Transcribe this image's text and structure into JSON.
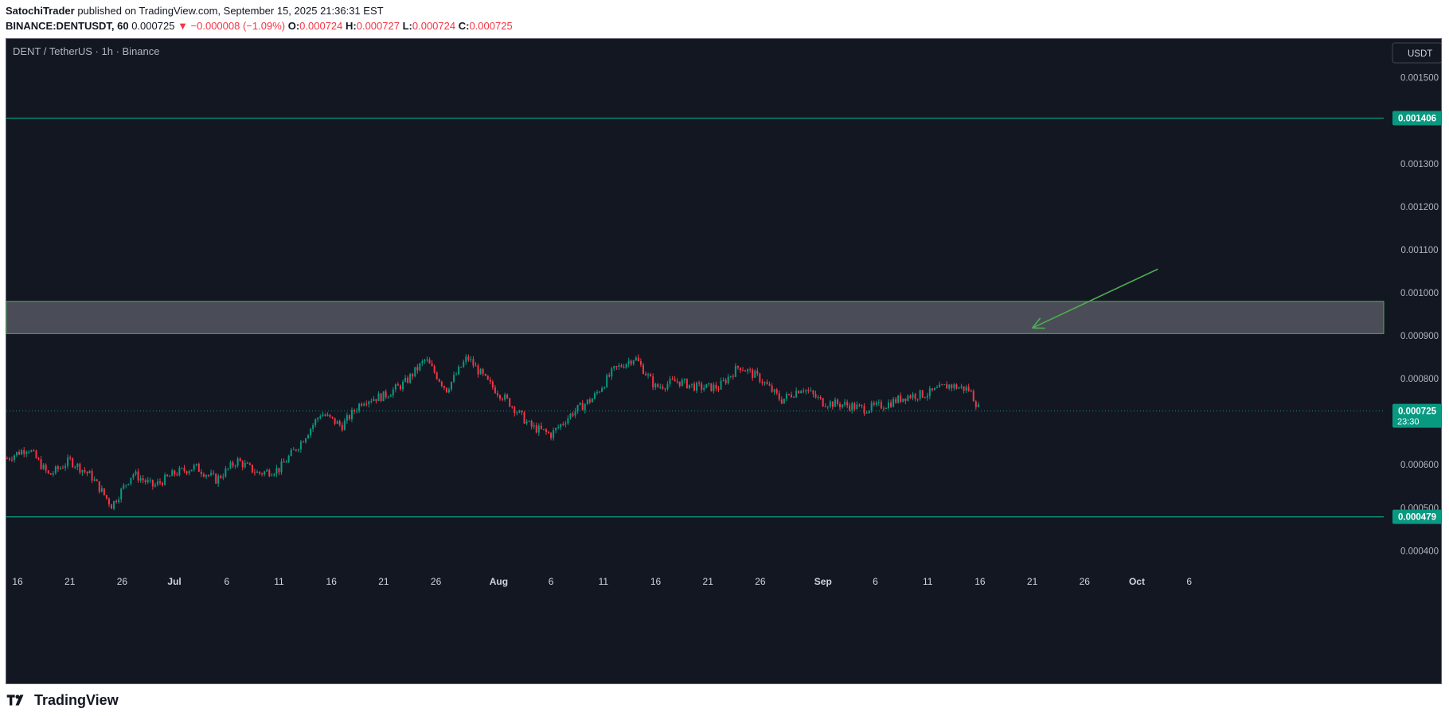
{
  "header": {
    "author": "SatochiTrader",
    "published": "published on TradingView.com, September 15, 2025 21:36:31 EST",
    "symbol": "BINANCE:DENTUSDT, 60",
    "last": "0.000725",
    "change": "▼ −0.000008 (−1.09%)",
    "o_label": "O:",
    "o": "0.000724",
    "h_label": "H:",
    "h": "0.000727",
    "l_label": "L:",
    "l": "0.000724",
    "c_label": "C:",
    "c": "0.000725"
  },
  "footer": {
    "brand": "TradingView"
  },
  "chart_data": {
    "type": "line",
    "title": "DENT / TetherUS · 1h · Binance",
    "currency_button": "USDT",
    "ylim": [
      0.00036,
      0.00159
    ],
    "y_ticks": [
      "0.001500",
      "0.001300",
      "0.001200",
      "0.001100",
      "0.001000",
      "0.000900",
      "0.000800",
      "0.000600",
      "0.000500",
      "0.000400"
    ],
    "x_ticks": [
      "16",
      "21",
      "26",
      "Jul",
      "6",
      "11",
      "16",
      "21",
      "26",
      "Aug",
      "6",
      "11",
      "16",
      "21",
      "26",
      "Sep",
      "6",
      "11",
      "16",
      "21",
      "26",
      "Oct",
      "6"
    ],
    "x_tick_dates": [
      "2025-06-16",
      "2025-06-21",
      "2025-06-26",
      "2025-07-01",
      "2025-07-06",
      "2025-07-11",
      "2025-07-16",
      "2025-07-21",
      "2025-07-26",
      "2025-08-01",
      "2025-08-06",
      "2025-08-11",
      "2025-08-16",
      "2025-08-21",
      "2025-08-26",
      "2025-09-01",
      "2025-09-06",
      "2025-09-11",
      "2025-09-16",
      "2025-09-21",
      "2025-09-26",
      "2025-10-01",
      "2025-10-06"
    ],
    "series": [
      {
        "x": [
          "2025-06-15",
          "2025-06-17",
          "2025-06-19",
          "2025-06-21",
          "2025-06-23",
          "2025-06-25",
          "2025-06-27",
          "2025-06-29",
          "2025-07-01",
          "2025-07-03",
          "2025-07-05",
          "2025-07-07",
          "2025-07-09",
          "2025-07-11",
          "2025-07-13",
          "2025-07-15",
          "2025-07-17",
          "2025-07-19",
          "2025-07-21",
          "2025-07-23",
          "2025-07-25",
          "2025-07-27",
          "2025-07-29",
          "2025-07-31",
          "2025-08-02",
          "2025-08-04",
          "2025-08-06",
          "2025-08-08",
          "2025-08-10",
          "2025-08-12",
          "2025-08-14",
          "2025-08-16",
          "2025-08-18",
          "2025-08-20",
          "2025-08-22",
          "2025-08-24",
          "2025-08-26",
          "2025-08-28",
          "2025-08-30",
          "2025-09-01",
          "2025-09-03",
          "2025-09-05",
          "2025-09-07",
          "2025-09-09",
          "2025-09-11",
          "2025-09-13",
          "2025-09-15",
          "2025-09-16"
        ],
        "y": [
          0.000615,
          0.00064,
          0.000575,
          0.00061,
          0.000575,
          0.000505,
          0.00058,
          0.00055,
          0.00058,
          0.000595,
          0.000565,
          0.00061,
          0.00058,
          0.00059,
          0.00065,
          0.00072,
          0.00069,
          0.00075,
          0.00076,
          0.00079,
          0.000845,
          0.000775,
          0.00085,
          0.00079,
          0.000745,
          0.00069,
          0.00067,
          0.00072,
          0.000755,
          0.00082,
          0.00085,
          0.00078,
          0.000795,
          0.00078,
          0.00078,
          0.00083,
          0.0008,
          0.00075,
          0.00078,
          0.000745,
          0.00074,
          0.00073,
          0.00074,
          0.00076,
          0.000765,
          0.000785,
          0.000775,
          0.000725
        ]
      }
    ],
    "horizontal_lines": [
      {
        "value": 0.001406,
        "label": "0.001406",
        "color": "#089981"
      },
      {
        "value": 0.000479,
        "label": "0.000479",
        "color": "#089981"
      }
    ],
    "zone": {
      "from": 0.000905,
      "to": 0.00098,
      "border_color": "#4caf50",
      "fill_color": "#4a4d57"
    },
    "arrow": {
      "from": [
        "2025-10-03",
        0.001055
      ],
      "to": [
        "2025-09-21",
        0.000918
      ],
      "color": "#4caf50"
    },
    "last_price": {
      "value": 0.000725,
      "label": "0.000725",
      "countdown": "23:30",
      "color": "#089981"
    },
    "colors": {
      "background": "#131722",
      "up": "#089981",
      "down": "#f23645",
      "text": "#b2b5be",
      "grid": "#1e222d"
    }
  }
}
